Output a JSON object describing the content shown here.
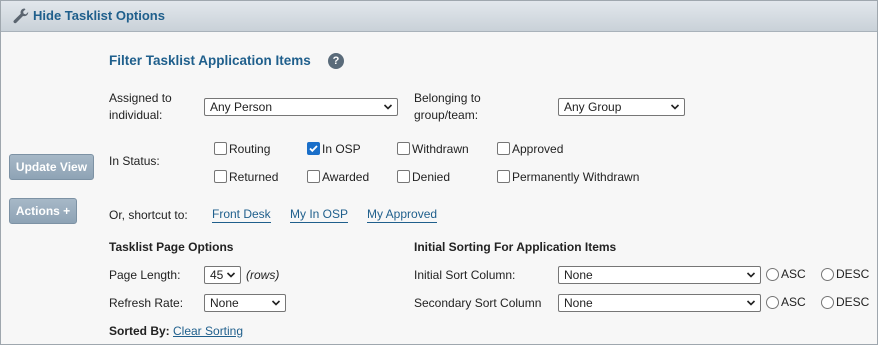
{
  "header": {
    "title": "Hide Tasklist Options",
    "icon": "wrench-icon"
  },
  "side_buttons": {
    "update_view": "Update View",
    "actions": "Actions +"
  },
  "filter": {
    "title": "Filter Tasklist Application Items",
    "help_icon": "?",
    "assigned_label_line1": "Assigned to",
    "assigned_label_line2": "individual:",
    "assigned_value": "Any Person",
    "belonging_label_line1": "Belonging to",
    "belonging_label_line2": "group/team:",
    "belonging_value": "Any Group",
    "status_label": "In Status:",
    "statuses": [
      {
        "label": "Routing",
        "checked": false
      },
      {
        "label": "In OSP",
        "checked": true
      },
      {
        "label": "Withdrawn",
        "checked": false
      },
      {
        "label": "Approved",
        "checked": false
      },
      {
        "label": "Returned",
        "checked": false
      },
      {
        "label": "Awarded",
        "checked": false
      },
      {
        "label": "Denied",
        "checked": false
      },
      {
        "label": "Permanently Withdrawn",
        "checked": false
      }
    ],
    "shortcut_label": "Or, shortcut to:",
    "shortcuts": [
      "Front Desk",
      "My In OSP",
      "My Approved"
    ]
  },
  "page_options": {
    "title": "Tasklist Page Options",
    "page_length_label": "Page Length:",
    "page_length_value": "45",
    "page_length_unit": "(rows)",
    "refresh_label": "Refresh Rate:",
    "refresh_value": "None",
    "sorted_by_label": "Sorted By:",
    "clear_sorting": "Clear Sorting"
  },
  "sorting": {
    "title": "Initial Sorting For Application Items",
    "initial_label": "Initial Sort Column:",
    "initial_value": "None",
    "secondary_label": "Secondary Sort Column",
    "secondary_value": "None",
    "asc": "ASC",
    "desc": "DESC"
  },
  "colors": {
    "accent": "#1f5f8c",
    "checkbox_checked": "#1a6fc9",
    "side_button": "#9aaec0"
  }
}
